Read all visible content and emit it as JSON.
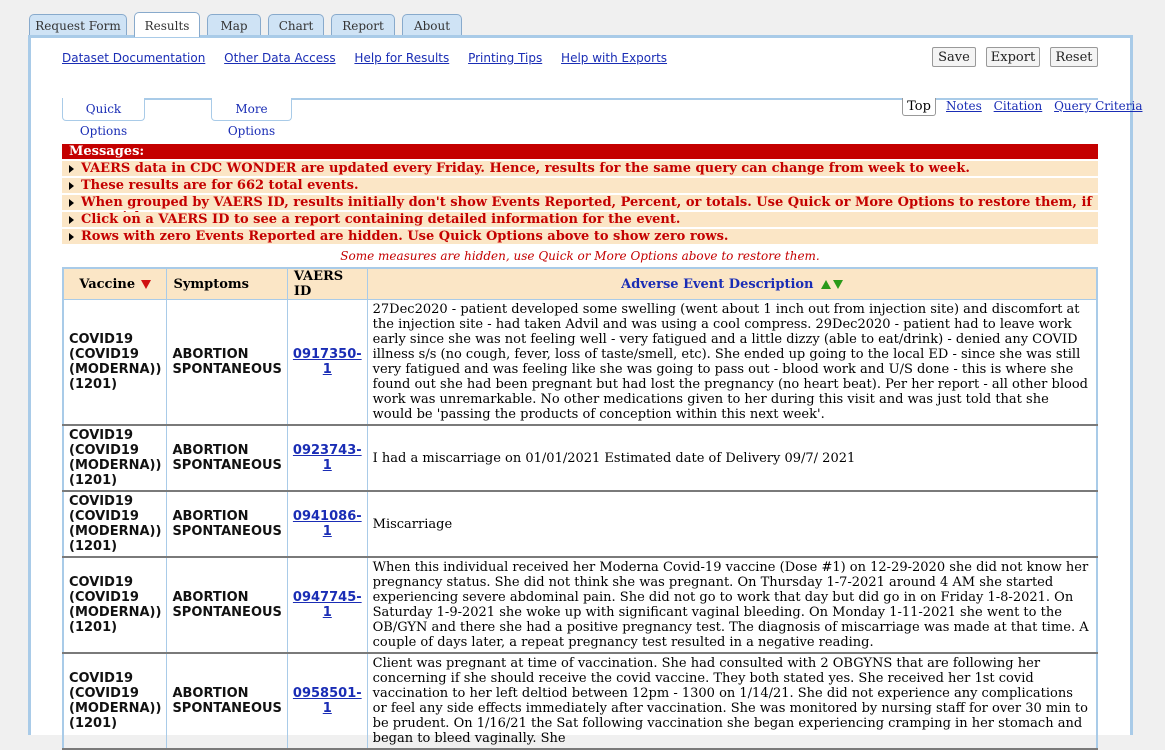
{
  "tabs": [
    "Request Form",
    "Results",
    "Map",
    "Chart",
    "Report",
    "About"
  ],
  "active_tab": "Results",
  "links": [
    "Dataset Documentation",
    "Other Data Access",
    "Help for Results",
    "Printing Tips",
    "Help with Exports"
  ],
  "buttons": {
    "save": "Save",
    "export": "Export",
    "reset": "Reset"
  },
  "options": {
    "quick": "Quick Options",
    "more": "More Options"
  },
  "nav": {
    "top": "Top",
    "notes": "Notes",
    "citation": "Citation",
    "query_criteria": "Query Criteria"
  },
  "messages": {
    "header": "Messages:",
    "items": [
      "VAERS data in CDC WONDER are updated every Friday. Hence, results for the same query can change from week to week.",
      "These results are for 662 total events.",
      "When grouped by VAERS ID, results initially don't show Events Reported, Percent, or totals. Use Quick or More Options to restore them, if you wish.",
      "Click on a VAERS ID to see a report containing detailed information for the event.",
      "Rows with zero Events Reported are hidden. Use Quick Options above to show zero rows."
    ],
    "hidden_note": "Some measures are hidden, use Quick or More Options above to restore them."
  },
  "table": {
    "headers": {
      "vaccine": "Vaccine",
      "symptoms": "Symptoms",
      "vaers_id": "VAERS ID",
      "description": "Adverse Event Description"
    },
    "rows": [
      {
        "vaccine": "COVID19 (COVID19 (MODERNA)) (1201)",
        "symptom": "ABORTION SPONTANEOUS",
        "id": "0917350-1",
        "desc": "27Dec2020 - patient developed some swelling (went about 1 inch out from injection site) and discomfort at the injection site - had taken Advil and was using a cool compress. 29Dec2020 - patient had to leave work early since she was not feeling well - very fatigued and a little dizzy (able to eat/drink) - denied any COVID illness s/s (no cough, fever, loss of taste/smell, etc). She ended up going to the local ED - since she was still very fatigued and was feeling like she was going to pass out - blood work and U/S done - this is where she found out she had been pregnant but had lost the pregnancy (no heart beat). Per her report - all other blood work was unremarkable. No other medications given to her during this visit and was just told that she would be 'passing the products of conception within this next week'."
      },
      {
        "vaccine": "COVID19 (COVID19 (MODERNA)) (1201)",
        "symptom": "ABORTION SPONTANEOUS",
        "id": "0923743-1",
        "desc": "I had a miscarriage on 01/01/2021 Estimated date of Delivery 09/7/ 2021"
      },
      {
        "vaccine": "COVID19 (COVID19 (MODERNA)) (1201)",
        "symptom": "ABORTION SPONTANEOUS",
        "id": "0941086-1",
        "desc": "Miscarriage"
      },
      {
        "vaccine": "COVID19 (COVID19 (MODERNA)) (1201)",
        "symptom": "ABORTION SPONTANEOUS",
        "id": "0947745-1",
        "desc": "When this individual received her Moderna Covid-19 vaccine (Dose #1) on 12-29-2020 she did not know her pregnancy status. She did not think she was pregnant. On Thursday 1-7-2021 around 4 AM she started experiencing severe abdominal pain. She did not go to work that day but did go in on Friday 1-8-2021. On Saturday 1-9-2021 she woke up with significant vaginal bleeding. On Monday 1-11-2021 she went to the OB/GYN and there she had a positive pregnancy test. The diagnosis of miscarriage was made at that time. A couple of days later, a repeat pregnancy test resulted in a negative reading."
      },
      {
        "vaccine": "COVID19 (COVID19 (MODERNA)) (1201)",
        "symptom": "ABORTION SPONTANEOUS",
        "id": "0958501-1",
        "desc": "Client was pregnant at time of vaccination. She had consulted with 2 OBGYNS that are following her concerning if she should receive the covid vaccine. They both stated yes. She received her 1st covid vaccination to her left deltiod between 12pm - 1300 on 1/14/21. She did not experience any complications or feel any side effects immediately after vaccination. She was monitored by nursing staff for over 30 min to be prudent. On 1/16/21 the Sat following vaccination she began experiencing cramping in her stomach and began to bleed vaginally. She"
      }
    ]
  }
}
